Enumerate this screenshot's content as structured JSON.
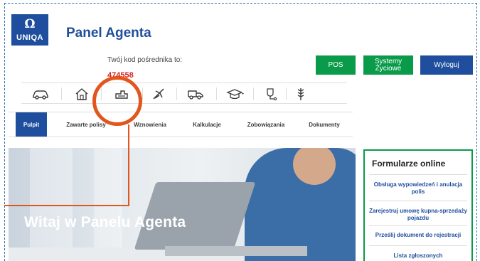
{
  "header": {
    "logo_text": "UNIQA",
    "logo_mark": "Ω",
    "title": "Panel Agenta",
    "agent_code_label": "Twój kod pośrednika to:",
    "agent_code_value": "474558"
  },
  "actions": {
    "pos": "POS",
    "systems": "Systemy Życiowe",
    "logout": "Wyloguj"
  },
  "icon_bar": {
    "icons": [
      "car-icon",
      "home-icon",
      "agro-machine-icon",
      "travel-plane-icon",
      "truck-icon",
      "graduation-cap-icon",
      "medical-icon",
      "wheat-icon"
    ]
  },
  "tabs": {
    "items": [
      {
        "label": "Pulpit",
        "active": true
      },
      {
        "label": "Zawarte polisy",
        "active": false
      },
      {
        "label": "Wznowienia",
        "active": false
      },
      {
        "label": "Kalkulacje",
        "active": false
      },
      {
        "label": "Zobowiązania",
        "active": false
      },
      {
        "label": "Dokumenty",
        "active": false
      }
    ]
  },
  "hero": {
    "title": "Witaj w Panelu Agenta"
  },
  "forms": {
    "title": "Formularze online",
    "links": [
      "Obsługa wypowiedzeń i anulacja polis",
      "Zarejestruj umowę kupna-sprzedaży pojazdu",
      "Prześlij dokument do rejestracji",
      "Lista zgłoszonych"
    ]
  },
  "colors": {
    "brand_blue": "#1e4e9d",
    "green": "#0a9b4a",
    "highlight_orange": "#e2551d",
    "code_red": "#d81e1e"
  }
}
